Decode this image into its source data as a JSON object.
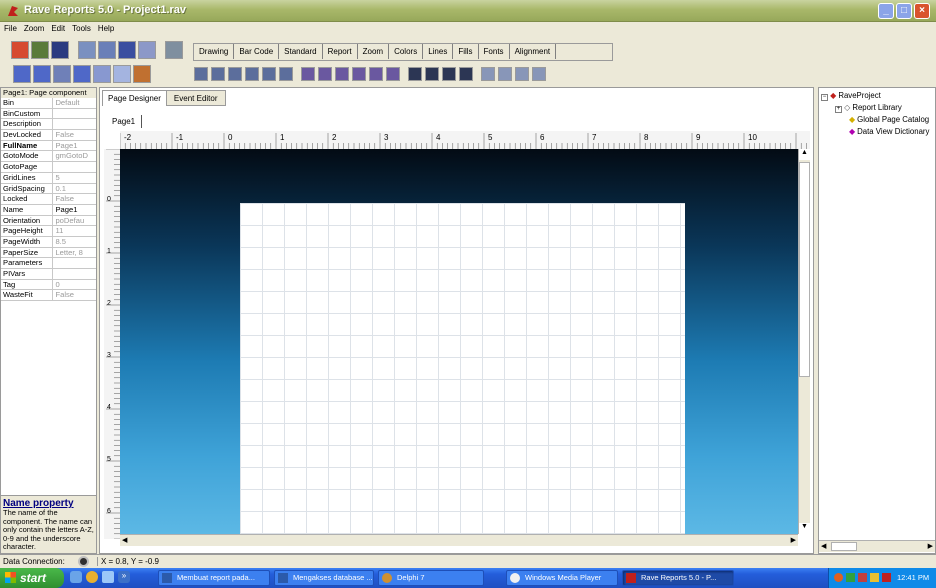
{
  "window": {
    "title": "Rave Reports 5.0 - Project1.rav"
  },
  "menu": [
    "File",
    "Zoom",
    "Edit",
    "Tools",
    "Help"
  ],
  "toolbox_tabs": [
    "Drawing",
    "Bar Code",
    "Standard",
    "Report",
    "Zoom",
    "Colors",
    "Lines",
    "Fills",
    "Fonts",
    "Alignment"
  ],
  "properties": {
    "header": "Page1: Page component",
    "rows": [
      {
        "k": "Bin",
        "v": "Default"
      },
      {
        "k": "BinCustom",
        "v": ""
      },
      {
        "k": "Description",
        "v": ""
      },
      {
        "k": "DevLocked",
        "v": "False"
      },
      {
        "k": "FullName",
        "v": "Page1"
      },
      {
        "k": "GotoMode",
        "v": "gmGotoD"
      },
      {
        "k": "GotoPage",
        "v": ""
      },
      {
        "k": "GridLines",
        "v": "5"
      },
      {
        "k": "GridSpacing",
        "v": "0.1"
      },
      {
        "k": "Locked",
        "v": "False"
      },
      {
        "k": "Name",
        "v": "Page1"
      },
      {
        "k": "Orientation",
        "v": "poDefau"
      },
      {
        "k": "PageHeight",
        "v": "11"
      },
      {
        "k": "PageWidth",
        "v": "8.5"
      },
      {
        "k": "PaperSize",
        "v": "Letter, 8"
      },
      {
        "k": "Parameters",
        "v": ""
      },
      {
        "k": "PIVars",
        "v": ""
      },
      {
        "k": "Tag",
        "v": "0"
      },
      {
        "k": "WasteFit",
        "v": "False"
      }
    ],
    "help_title": "Name property",
    "help_text": "The name of the component. The name can only contain the letters A-Z, 0-9 and the underscore character."
  },
  "designer": {
    "tabs": [
      "Page Designer",
      "Event Editor"
    ],
    "page_tab": "Page1",
    "ruler_labels": [
      "-2",
      "-1",
      "0",
      "1",
      "2",
      "3",
      "4",
      "5",
      "6",
      "7",
      "8",
      "9",
      "10"
    ],
    "vruler_labels": [
      "0",
      "1",
      "2",
      "3",
      "4",
      "5",
      "6"
    ]
  },
  "project_tree": {
    "root": "RaveProject",
    "items": [
      "Report Library",
      "Global Page Catalog",
      "Data View Dictionary"
    ]
  },
  "status": {
    "label": "Data Connection:",
    "coords": "X = 0.8, Y = -0.9"
  },
  "taskbar": {
    "start": "start",
    "tasks": [
      "Membuat report pada...",
      "Mengakses database ...",
      "Delphi 7",
      "Windows Media Player",
      "Rave Reports 5.0 - P..."
    ],
    "clock": "12:41 PM"
  }
}
